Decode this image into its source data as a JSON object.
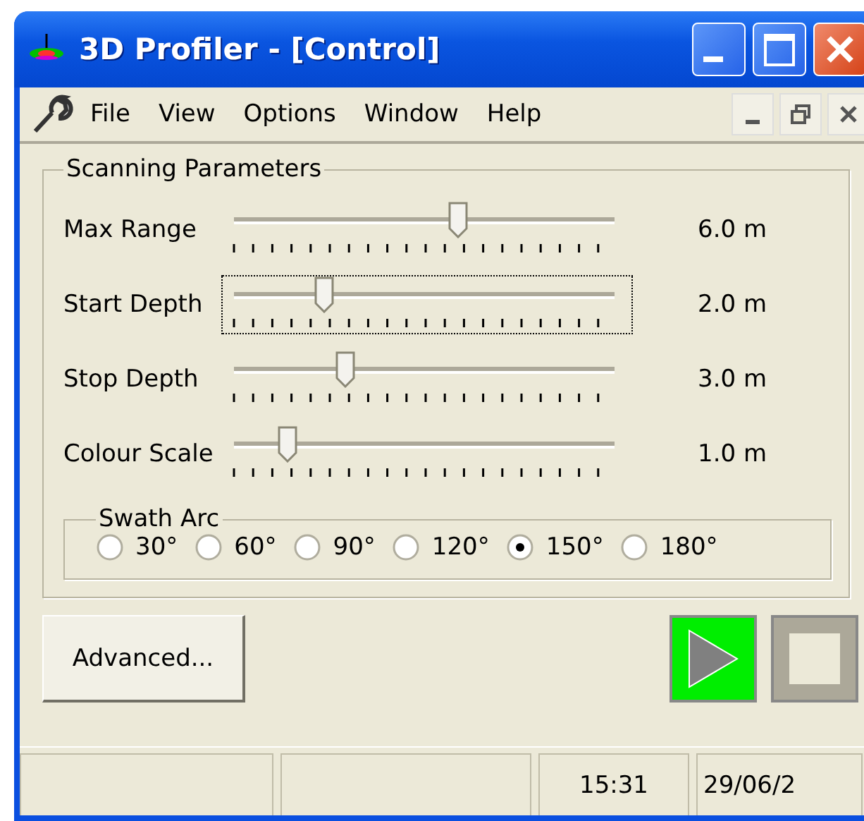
{
  "window": {
    "title": "3D Profiler - [Control]"
  },
  "menu": [
    "File",
    "View",
    "Options",
    "Window",
    "Help"
  ],
  "scanning_parameters": {
    "title": "Scanning Parameters",
    "sliders": [
      {
        "label": "Max Range",
        "level": 0.59,
        "reading": "6.0 m",
        "focused": false
      },
      {
        "label": "Start Depth",
        "level": 0.22,
        "reading": "2.0 m",
        "focused": true
      },
      {
        "label": "Stop Depth",
        "level": 0.28,
        "reading": "3.0 m",
        "focused": false
      },
      {
        "label": "Colour Scale",
        "level": 0.12,
        "reading": "1.0 m",
        "focused": false
      }
    ],
    "swath_arc": {
      "title": "Swath Arc",
      "options": [
        {
          "label": "30°",
          "selected": false
        },
        {
          "label": "60°",
          "selected": false
        },
        {
          "label": "90°",
          "selected": false
        },
        {
          "label": "120°",
          "selected": false
        },
        {
          "label": "150°",
          "selected": true
        },
        {
          "label": "180°",
          "selected": false
        }
      ]
    }
  },
  "buttons": {
    "advanced": "Advanced..."
  },
  "status_bar": {
    "time": "15:31",
    "date": "29/06/2"
  }
}
